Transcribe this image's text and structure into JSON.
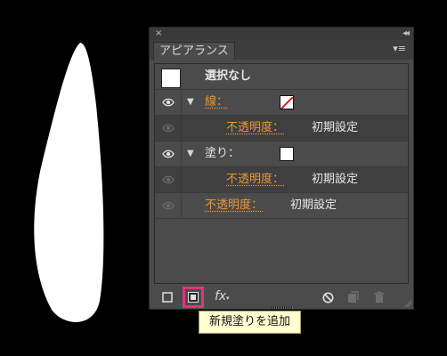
{
  "panel": {
    "close_glyph": "×",
    "collapse_glyph": "◂◂",
    "tab_label": "アピアランス",
    "menu_glyph": "▾≡"
  },
  "rows": {
    "selection": "選択なし",
    "stroke_label": "線：",
    "stroke_opacity_label": "不透明度：",
    "stroke_opacity_value": "初期設定",
    "fill_label": "塗り：",
    "fill_opacity_label": "不透明度：",
    "fill_opacity_value": "初期設定",
    "object_opacity_label": "不透明度：",
    "object_opacity_value": "初期設定"
  },
  "toolbar": {
    "fx_label": "fx"
  },
  "tooltip": {
    "text": "新規塗りを追加"
  },
  "colors": {
    "accent_label": "#e8973a",
    "highlight": "#e9317c",
    "tooltip_bg": "#ffffd2"
  },
  "icons": [
    "eye-icon",
    "disclosure-triangle-icon",
    "none-swatch-icon",
    "square-outline-icon",
    "new-fill-icon",
    "fx-icon",
    "clear-icon",
    "duplicate-icon",
    "trash-icon"
  ]
}
